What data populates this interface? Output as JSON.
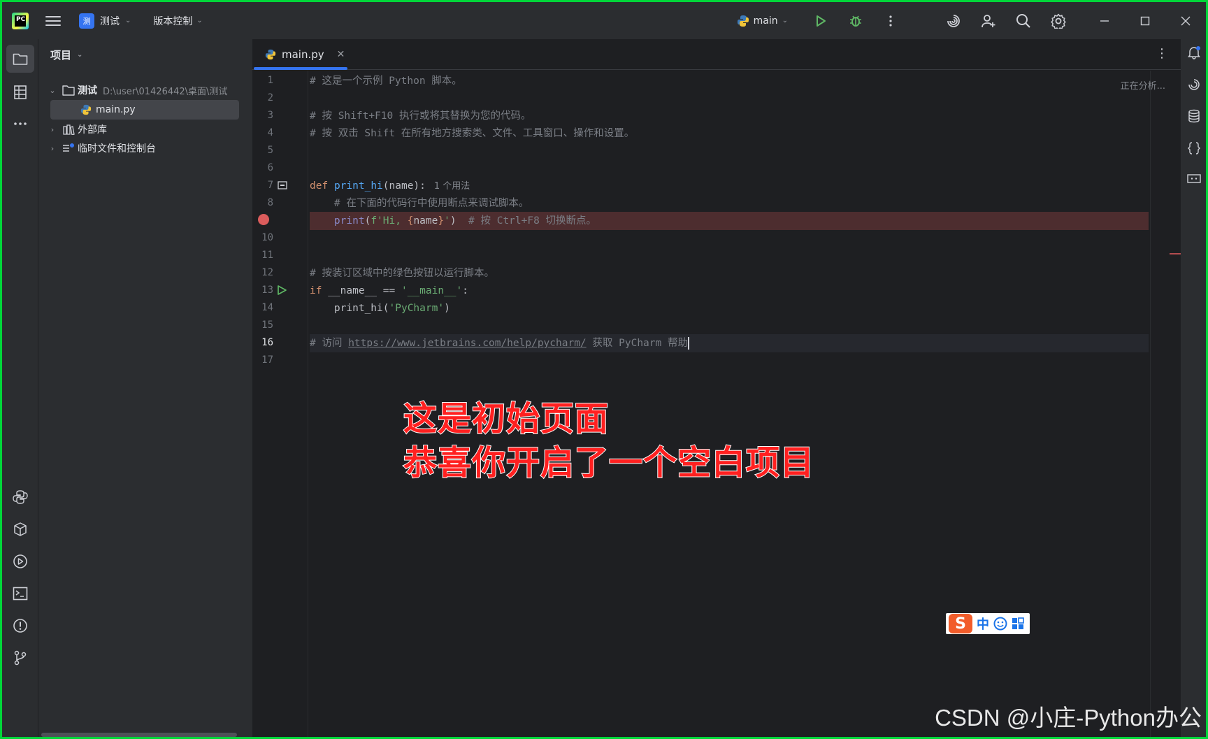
{
  "titlebar": {
    "project_badge": "测",
    "project_name": "测试",
    "vcs_label": "版本控制",
    "run_config": "main"
  },
  "project_panel": {
    "header": "项目",
    "tree": [
      {
        "label": "测试",
        "path": "D:\\user\\01426442\\桌面\\测试"
      },
      {
        "label": "main.py"
      },
      {
        "label": "外部库"
      },
      {
        "label": "临时文件和控制台"
      }
    ]
  },
  "editor": {
    "tab_label": "main.py",
    "status": "正在分析...",
    "line_numbers": [
      "1",
      "2",
      "3",
      "4",
      "5",
      "6",
      "7",
      "8",
      "9",
      "10",
      "11",
      "12",
      "13",
      "14",
      "15",
      "16",
      "17"
    ],
    "current_line": "16",
    "breakpoint_line": "9",
    "lines": {
      "l1": "# 这是一个示例 Python 脚本。",
      "l3": "# 按 Shift+F10 执行或将其替换为您的代码。",
      "l4": "# 按 双击 Shift 在所有地方搜索类、文件、工具窗口、操作和设置。",
      "l7_kw": "def",
      "l7_fn": "print_hi",
      "l7_rest": "(name):",
      "l7_hint": "1 个用法",
      "l8": "    # 在下面的代码行中使用断点来调试脚本。",
      "l9_indent": "    ",
      "l9_fn": "print",
      "l9_p1": "(",
      "l9_str1": "f'Hi, ",
      "l9_brace_open": "{",
      "l9_name": "name",
      "l9_brace_close": "}",
      "l9_str2": "'",
      "l9_p2": ")  ",
      "l9_comment": "# 按 Ctrl+F8 切换断点。",
      "l12": "# 按装订区域中的绿色按钮以运行脚本。",
      "l13_kw": "if",
      "l13_mid": " __name__ == ",
      "l13_str": "'__main__'",
      "l13_end": ":",
      "l14_pre": "    print_hi(",
      "l14_str": "'PyCharm'",
      "l14_end": ")",
      "l16_pre": "# 访问 ",
      "l16_url": "https://www.jetbrains.com/help/pycharm/",
      "l16_post": " 获取 PyCharm 帮助"
    }
  },
  "overlay": {
    "line1": "这是初始页面",
    "line2": "恭喜你开启了一个空白项目"
  },
  "ime": {
    "logo": "S",
    "mode": "中"
  },
  "watermark": "CSDN @小庄-Python办公",
  "colors": {
    "accent": "#3574f0",
    "run_green": "#5fb865",
    "breakpoint": "#db5c5c",
    "frame_border": "#00d639",
    "overlay_text": "#ff2020"
  }
}
